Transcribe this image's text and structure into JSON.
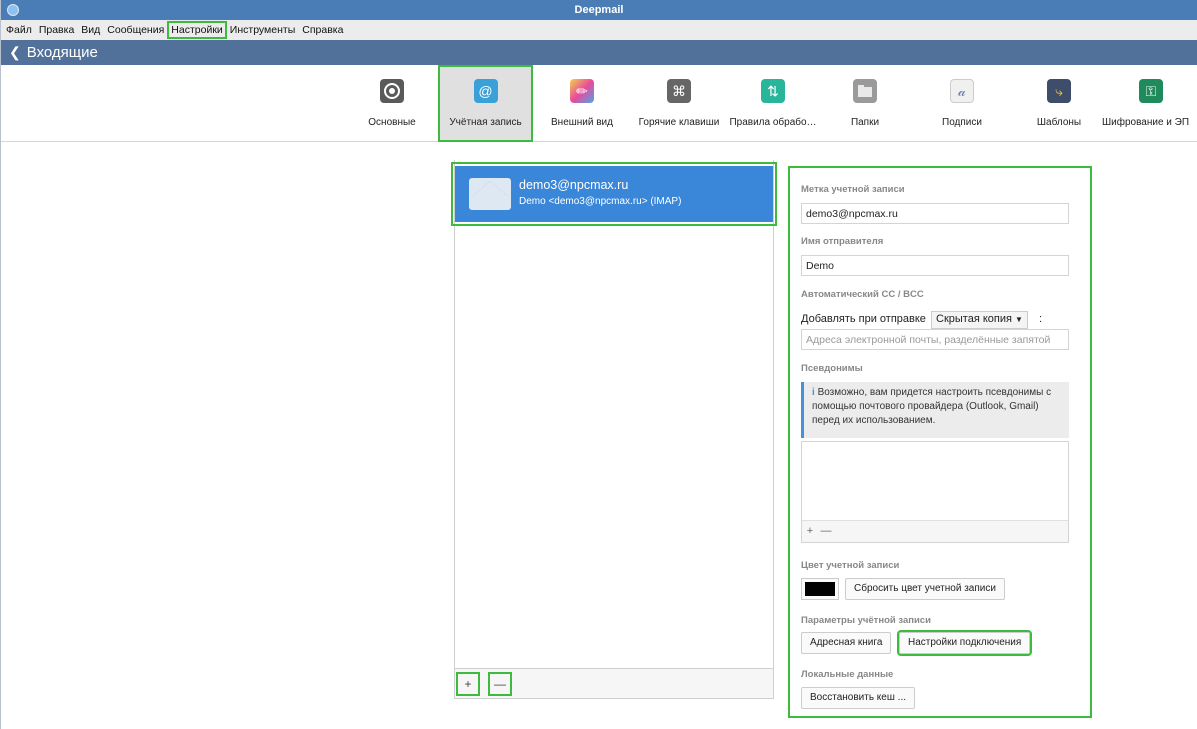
{
  "window": {
    "title": "Deepmail"
  },
  "menu": [
    "Файл",
    "Правка",
    "Вид",
    "Сообщения",
    "Настройки",
    "Инструменты",
    "Справка"
  ],
  "nav": {
    "back_label": "Входящие"
  },
  "toolbar": {
    "items": [
      {
        "label": "Основные",
        "icon": "gear-icon",
        "color": "#5a5a5a"
      },
      {
        "label": "Учётная запись",
        "icon": "at-sign-icon",
        "color": "#3aa0d8"
      },
      {
        "label": "Внешний вид",
        "icon": "palette-icon",
        "color": "#e94b9a"
      },
      {
        "label": "Горячие клавиши",
        "icon": "command-key-icon",
        "color": "#666666"
      },
      {
        "label": "Правила обрабо…",
        "icon": "rules-arrows-icon",
        "color": "#29b59a"
      },
      {
        "label": "Папки",
        "icon": "folder-icon",
        "color": "#9a9a9a"
      },
      {
        "label": "Подписи",
        "icon": "signature-icon",
        "color": "#f0f0f0"
      },
      {
        "label": "Шаблоны",
        "icon": "template-icon",
        "color": "#3e4e6a"
      },
      {
        "label": "Шифрование и ЭП",
        "icon": "key-icon",
        "color": "#1f8a5c"
      }
    ]
  },
  "account": {
    "email": "demo3@npcmax.ru",
    "description": "Demo <demo3@npcmax.ru> (IMAP)",
    "add_label": "+",
    "remove_label": "—"
  },
  "settings": {
    "label_section": "Метка учетной записи",
    "label_value": "demo3@npcmax.ru",
    "sender_section": "Имя отправителя",
    "sender_value": "Demo",
    "auto_cc_section": "Автоматический CC / BCC",
    "add_on_send_label": "Добавлять при отправке",
    "copy_type": "Скрытая копия",
    "colon": ":",
    "cc_placeholder": "Адреса электронной почты, разделённые запятой",
    "aliases_section": "Псевдонимы",
    "aliases_info": "Возможно, вам придется настроить псевдонимы с помощью почтового провайдера (Outlook, Gmail) перед их использованием.",
    "aliases_info_icon": "i",
    "alias_add": "+",
    "alias_remove": "—",
    "color_section": "Цвет учетной записи",
    "account_color": "#000000",
    "reset_color_button": "Сбросить цвет учетной записи",
    "params_section": "Параметры учётной записи",
    "address_book_button": "Адресная книга",
    "connection_button": "Настройки подключения",
    "local_section": "Локальные данные",
    "restore_cache_button": "Восстановить кеш ..."
  }
}
